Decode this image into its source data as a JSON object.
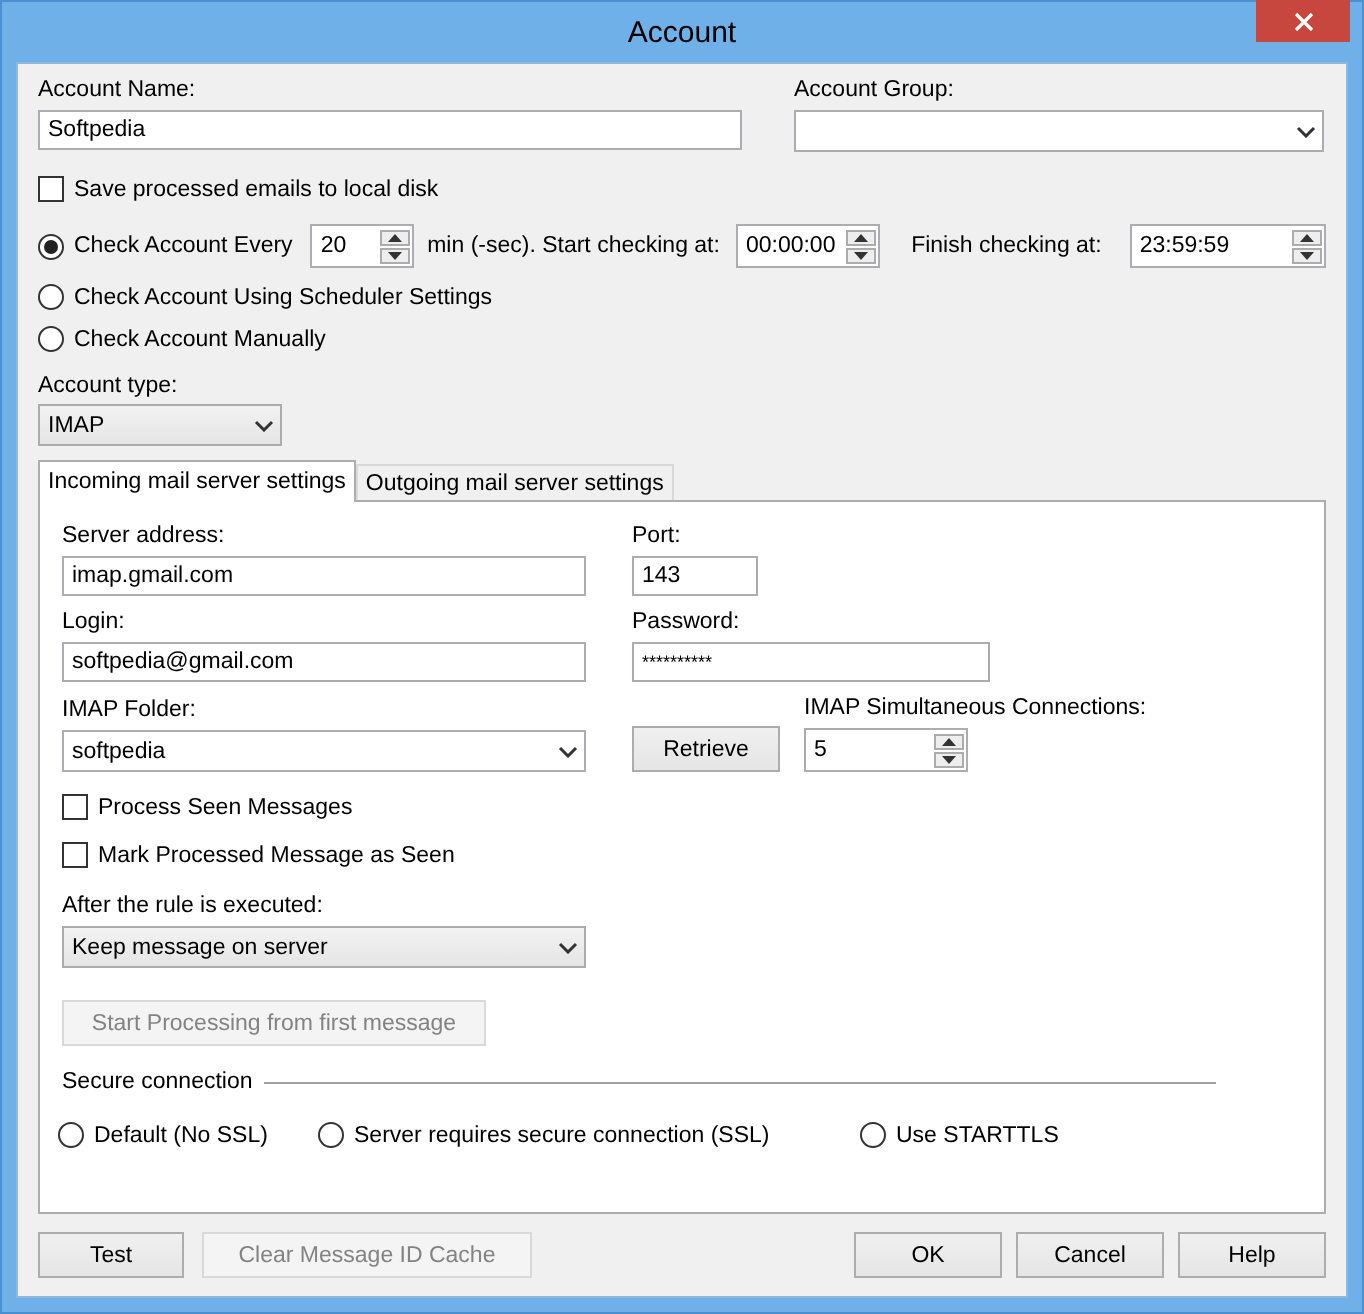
{
  "window": {
    "title": "Account"
  },
  "account_name": {
    "label": "Account Name:",
    "value": "Softpedia"
  },
  "account_group": {
    "label": "Account Group:"
  },
  "save_to_disk": {
    "label": "Save processed emails to local disk",
    "checked": false
  },
  "check_modes": [
    {
      "label": "Check Account Every",
      "selected": true
    },
    {
      "label": "Check Account Using Scheduler Settings",
      "selected": false
    },
    {
      "label": "Check Account Manually",
      "selected": false
    }
  ],
  "interval": {
    "value": "20",
    "unit_label": "min (-sec). Start checking at:",
    "start": "00:00:00",
    "finish_label": "Finish checking at:",
    "finish": "23:59:59"
  },
  "account_type": {
    "label": "Account type:",
    "value": "IMAP"
  },
  "tabs": [
    {
      "label": "Incoming mail server settings",
      "selected": true
    },
    {
      "label": "Outgoing mail server settings",
      "selected": false
    }
  ],
  "incoming": {
    "server": {
      "label": "Server address:",
      "value": "imap.gmail.com"
    },
    "port": {
      "label": "Port:",
      "value": "143"
    },
    "login": {
      "label": "Login:",
      "value": "softpedia@gmail.com"
    },
    "password": {
      "label": "Password:",
      "value": "**********"
    },
    "folder": {
      "label": "IMAP Folder:",
      "value": "softpedia"
    },
    "retrieve": {
      "label": "Retrieve"
    },
    "connections": {
      "label": "IMAP Simultaneous Connections:",
      "value": "5"
    },
    "options": [
      {
        "label": "Process Seen Messages",
        "checked": false
      },
      {
        "label": "Mark Processed Message as Seen",
        "checked": false
      }
    ],
    "after_rule": {
      "label": "After the rule is executed:",
      "value": "Keep message on server"
    },
    "start_processing": {
      "label": "Start Processing from first message",
      "disabled": true
    },
    "secure": {
      "title": "Secure connection",
      "options": [
        {
          "label": "Default (No SSL)",
          "selected": false
        },
        {
          "label": "Server requires secure connection (SSL)",
          "selected": false
        },
        {
          "label": "Use STARTTLS",
          "selected": false
        }
      ]
    }
  },
  "left_buttons": [
    {
      "label": "Test",
      "disabled": false
    },
    {
      "label": "Clear Message ID Cache",
      "disabled": true
    }
  ],
  "right_buttons": [
    {
      "label": "OK",
      "disabled": false
    },
    {
      "label": "Cancel",
      "disabled": false
    },
    {
      "label": "Help",
      "disabled": false
    }
  ]
}
